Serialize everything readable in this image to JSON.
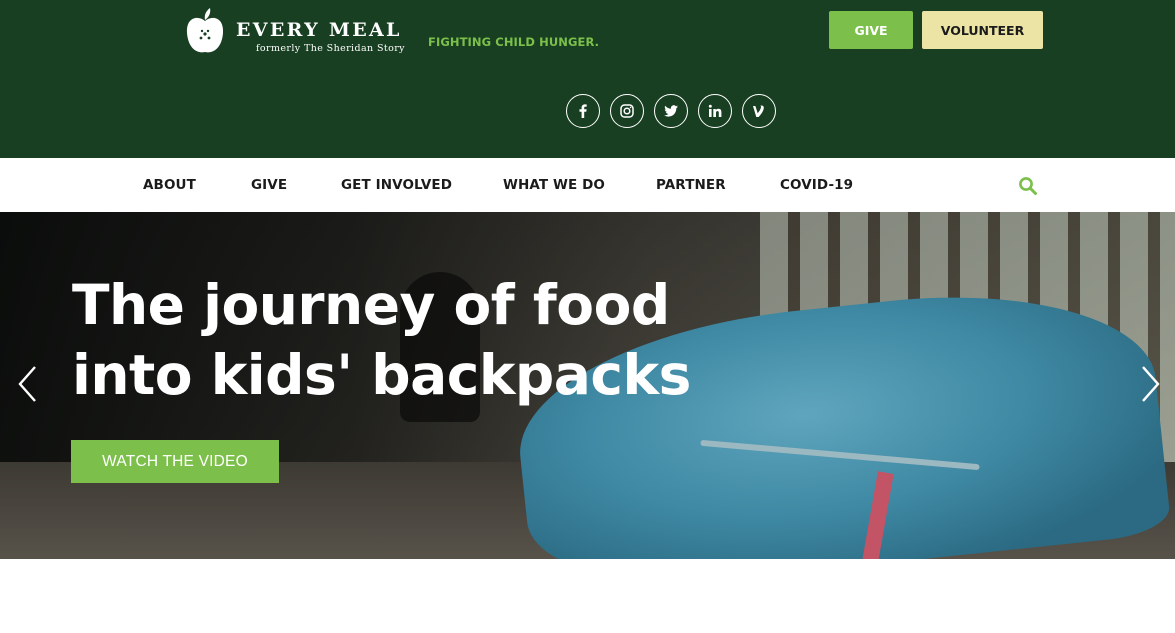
{
  "brand": {
    "name": "EVERY MEAL",
    "subtitle": "formerly The Sheridan Story",
    "tagline": "FIGHTING CHILD HUNGER."
  },
  "header_buttons": {
    "give": "GIVE",
    "volunteer": "VOLUNTEER"
  },
  "social": [
    "facebook-icon",
    "instagram-icon",
    "twitter-icon",
    "linkedin-icon",
    "vine-icon"
  ],
  "nav": {
    "items": [
      "ABOUT",
      "GIVE",
      "GET INVOLVED",
      "WHAT WE DO",
      "PARTNER",
      "COVID-19"
    ]
  },
  "hero": {
    "title_line1": "The journey of food",
    "title_line2": "into kids' backpacks",
    "cta": "WATCH THE VIDEO"
  },
  "colors": {
    "header_bg": "#183f22",
    "accent_green": "#7cc04b",
    "volunteer_bg": "#ece4a4"
  }
}
